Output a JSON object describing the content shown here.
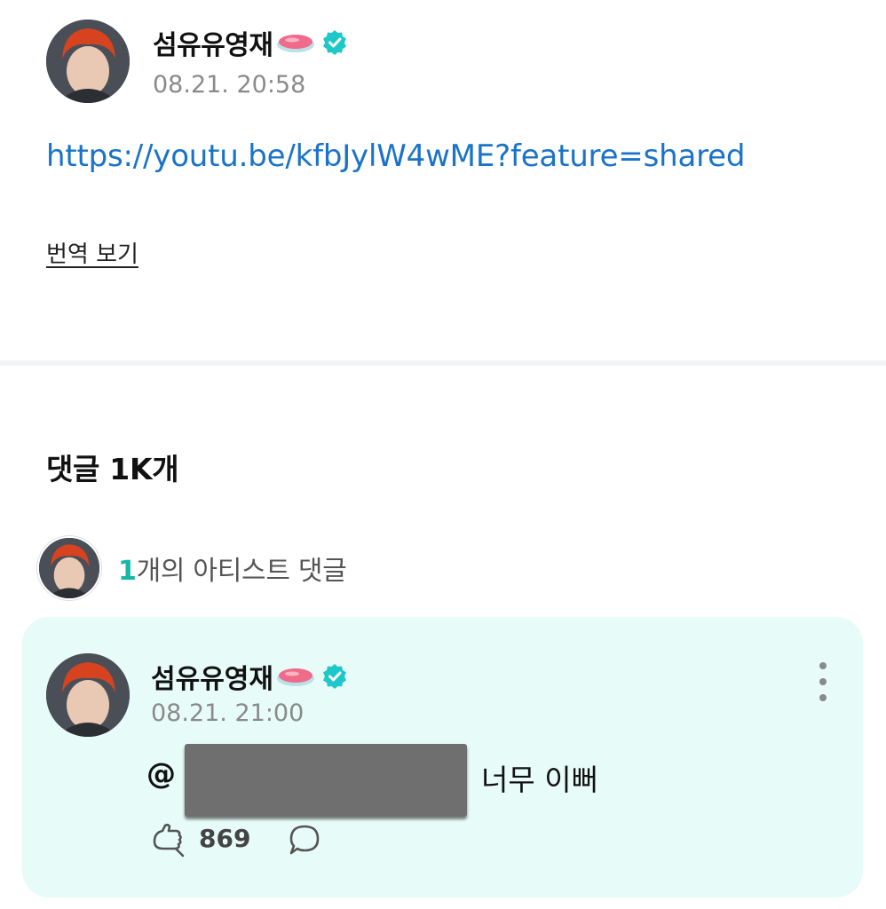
{
  "post": {
    "author": "섬유유영재",
    "timestamp": "08.21. 20:58",
    "link": "https://youtu.be/kfbJylW4wME?feature=shared",
    "translate_label": "번역 보기"
  },
  "comments": {
    "title": "댓글 1K개",
    "artist_count": "1",
    "artist_label": "개의 아티스트 댓글"
  },
  "comment": {
    "author": "섬유유영재",
    "timestamp": "08.21. 21:00",
    "mention_prefix": "@",
    "text": "너무 이뻐",
    "like_count": "869"
  },
  "colors": {
    "accent": "#14b8a6",
    "link": "#1a73c8",
    "card_bg": "#e7fcf8",
    "verified": "#1ec8c8"
  },
  "icons": {
    "verified": "verified-badge-icon",
    "emoji": "pink-soap-emoji-icon",
    "like": "like-hand-icon",
    "reply": "comment-bubble-icon",
    "more": "more-vertical-icon"
  }
}
